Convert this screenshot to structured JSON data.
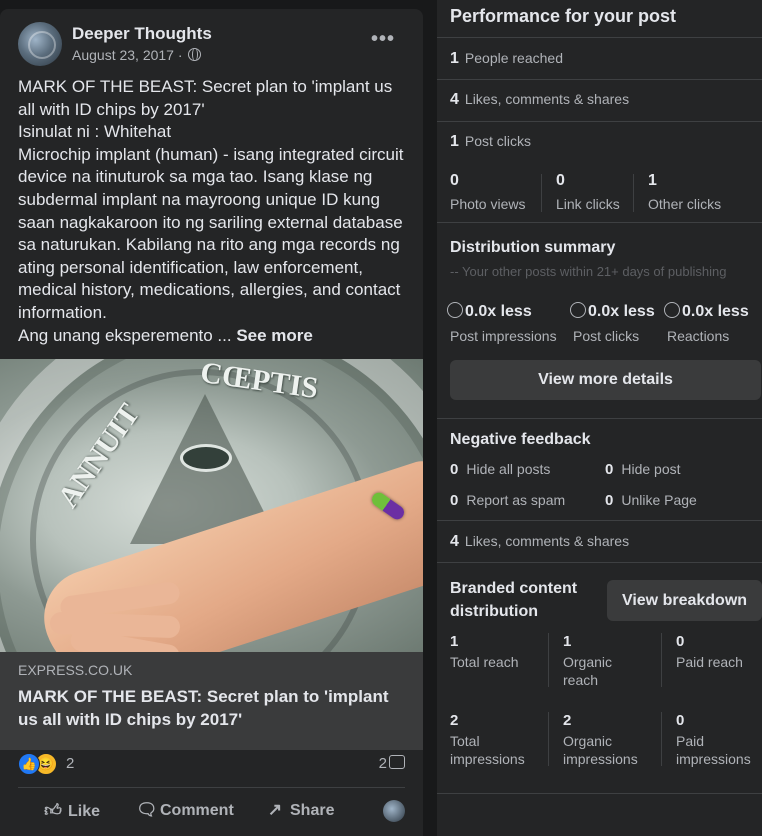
{
  "post": {
    "page_name": "Deeper Thoughts",
    "date": "August 23, 2017 ·",
    "more_label": "•••",
    "text_lines": [
      "MARK OF THE BEAST: Secret plan to 'implant us all with ID chips by 2017'",
      "Isinulat ni : Whitehat",
      "Microchip implant (human) - isang integrated circuit device na itinuturok sa mga tao. Isang klase ng subdermal implant na mayroong unique ID kung saan nagkakaroon ito ng sariling external database sa naturukan. Kabilang na rito ang mga records ng ating personal identification, law enforcement, medical history, medications, allergies, and contact information.",
      "Ang unang eksperemento ..."
    ],
    "see_more": "See more",
    "image_words": [
      "CŒPTIS",
      "ANNUIT"
    ],
    "link_domain": "EXPRESS.CO.UK",
    "link_title": "MARK OF THE BEAST: Secret plan to 'implant us all with ID chips by 2017'",
    "reaction_count": "2",
    "comment_count": "2",
    "actions": {
      "like": "Like",
      "comment": "Comment",
      "share": "Share"
    },
    "colors": {
      "like_blue": "#2078f4",
      "haha_yellow": "#f7b928"
    }
  },
  "insights": {
    "title": "Performance for your post",
    "people_reached": {
      "num": "1",
      "label": "People reached"
    },
    "engagement": {
      "num": "4",
      "label": "Likes, comments & shares"
    },
    "post_clicks": {
      "num": "1",
      "label": "Post clicks"
    },
    "clicks_breakdown": [
      {
        "num": "0",
        "label": "Photo views"
      },
      {
        "num": "0",
        "label": "Link clicks"
      },
      {
        "num": "1",
        "label": "Other clicks"
      }
    ],
    "distribution": {
      "title": "Distribution summary",
      "subtitle": "-- Your other posts within 21+ days of publishing",
      "items": [
        {
          "value": "0.0x less",
          "label": "Post impressions"
        },
        {
          "value": "0.0x less",
          "label": "Post clicks"
        },
        {
          "value": "0.0x less",
          "label": "Reactions"
        }
      ],
      "button": "View more details"
    },
    "negative_feedback": {
      "title": "Negative feedback",
      "items": [
        {
          "num": "0",
          "label": "Hide all posts"
        },
        {
          "num": "0",
          "label": "Hide post"
        },
        {
          "num": "0",
          "label": "Report as spam"
        },
        {
          "num": "0",
          "label": "Unlike Page"
        }
      ]
    },
    "engagement2": {
      "num": "4",
      "label": "Likes, comments & shares"
    },
    "branded": {
      "title": "Branded content distribution",
      "button": "View breakdown",
      "reach": [
        {
          "num": "1",
          "label": "Total reach"
        },
        {
          "num": "1",
          "label": "Organic reach"
        },
        {
          "num": "0",
          "label": "Paid reach"
        }
      ],
      "impressions": [
        {
          "num": "2",
          "label": "Total impressions"
        },
        {
          "num": "2",
          "label": "Organic impressions"
        },
        {
          "num": "0",
          "label": "Paid impressions"
        }
      ]
    }
  }
}
